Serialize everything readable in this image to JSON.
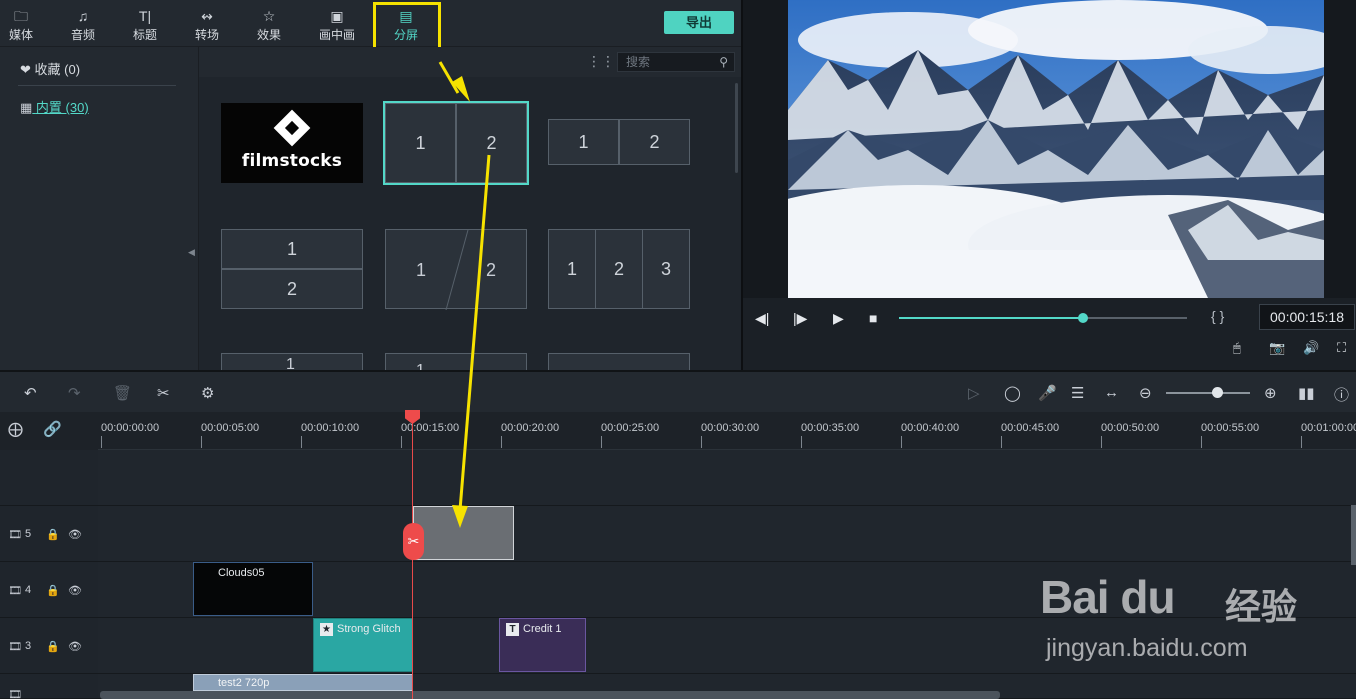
{
  "toolbar": {
    "tabs": [
      {
        "label": "媒体",
        "icon": "folder-icon"
      },
      {
        "label": "音频",
        "icon": "music-note-icon"
      },
      {
        "label": "标题",
        "icon": "text-icon"
      },
      {
        "label": "转场",
        "icon": "transition-icon"
      },
      {
        "label": "效果",
        "icon": "effects-icon"
      },
      {
        "label": "画中画",
        "icon": "image-icon"
      },
      {
        "label": "分屏",
        "icon": "split-screen-icon",
        "active": true
      }
    ],
    "export_label": "导出"
  },
  "sidebar": {
    "favorites": "收藏 (0)",
    "builtin": "内置 (30)"
  },
  "content": {
    "search_placeholder": "搜索",
    "filmstocks_label": "filmstocks",
    "tiles": [
      {
        "id": "split-2-vertical-selected",
        "panes": [
          "1",
          "2"
        ]
      },
      {
        "id": "split-2-vertical",
        "panes": [
          "1",
          "2"
        ]
      },
      {
        "id": "split-2-horizontal",
        "panes": [
          "1",
          "2"
        ]
      },
      {
        "id": "split-2-diagonal",
        "panes": [
          "1",
          "2"
        ]
      },
      {
        "id": "split-3-vertical",
        "panes": [
          "1",
          "2",
          "3"
        ]
      }
    ],
    "partial_labels": [
      "1",
      "1"
    ]
  },
  "preview": {
    "timecode": "00:00:15:18",
    "progress": 0.64,
    "brackets": "{  }"
  },
  "timeline": {
    "ruler_labels": [
      "00:00:00:00",
      "00:00:05:00",
      "00:00:10:00",
      "00:00:15:00",
      "00:00:20:00",
      "00:00:25:00",
      "00:00:30:00",
      "00:00:35:00",
      "00:00:40:00",
      "00:00:45:00",
      "00:00:50:00",
      "00:00:55:00",
      "00:01:00:00"
    ],
    "tracks": [
      {
        "number": "5"
      },
      {
        "number": "4"
      },
      {
        "number": "3"
      }
    ],
    "clips": {
      "clouds": "Clouds05",
      "glitch": "Strong Glitch",
      "credit": "Credit 1",
      "video": "test2 720p"
    }
  },
  "watermark": {
    "main": "Bai du",
    "cn": "经验",
    "sub": "jingyan.baidu.com"
  },
  "colors": {
    "accent": "#53d8c8",
    "highlight": "#f6e200",
    "playhead": "#ee4b4b",
    "clip_glitch": "#2aa7a3",
    "clip_credit": "#3a2d57"
  }
}
